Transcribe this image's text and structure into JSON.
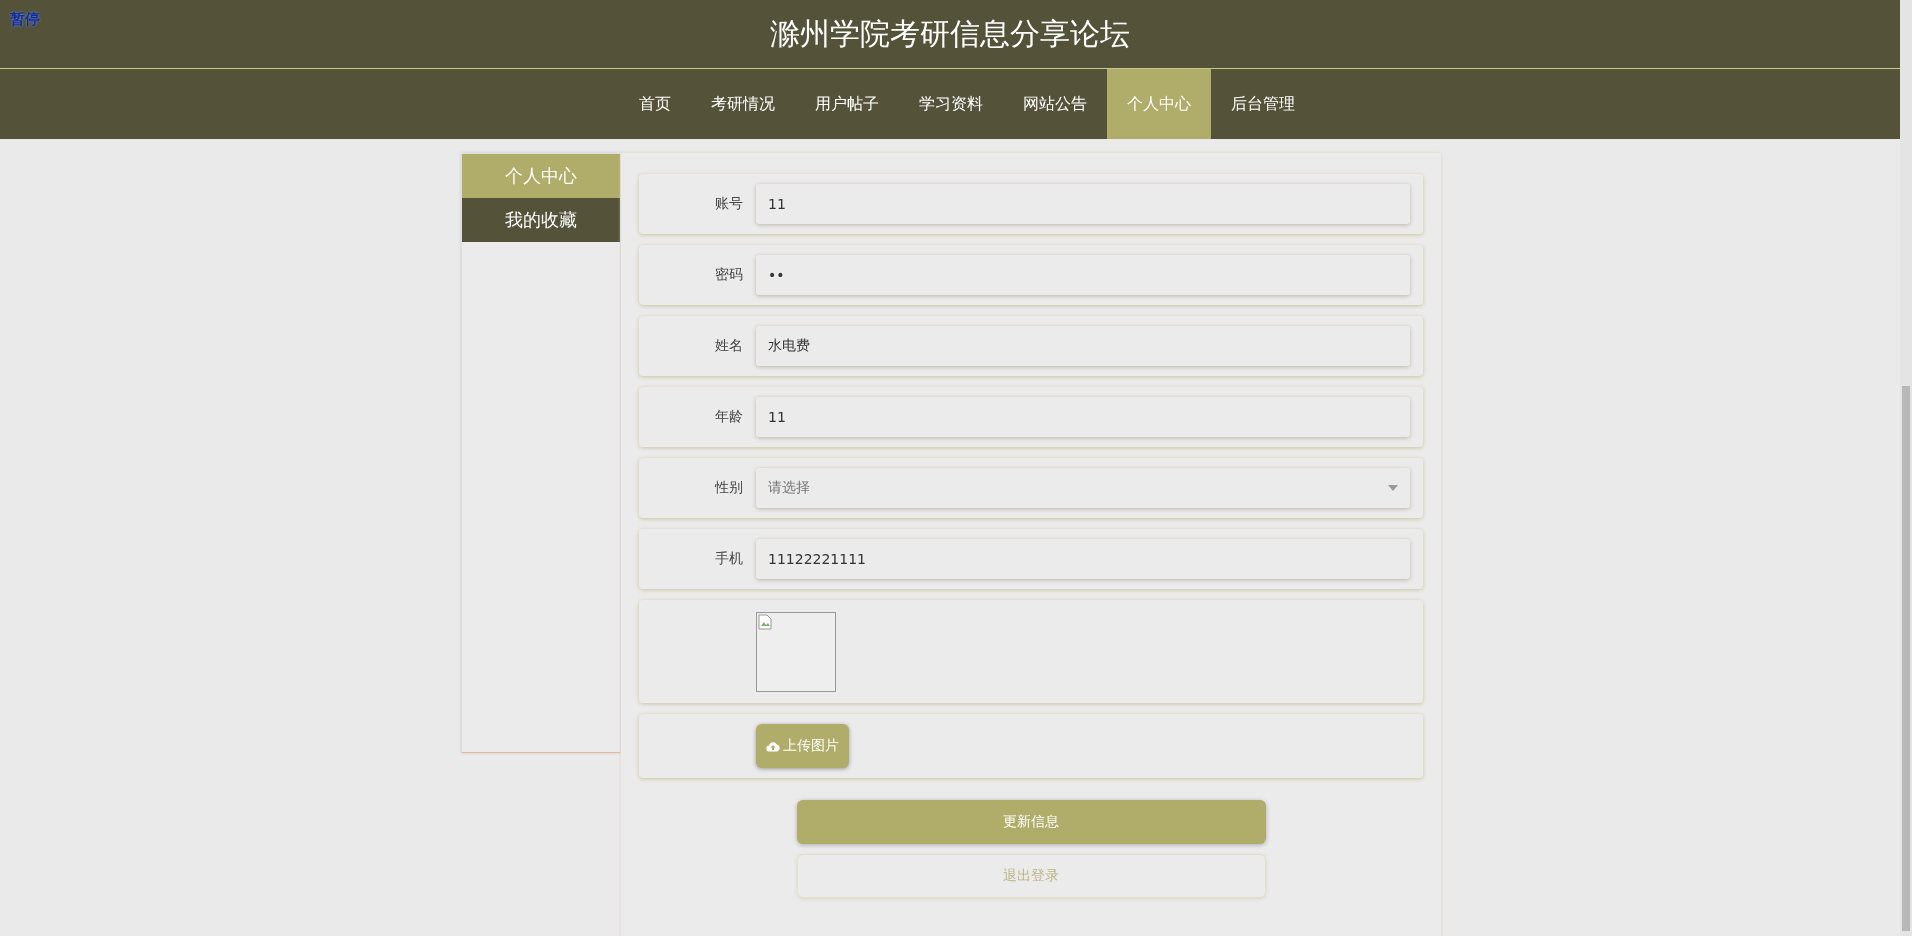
{
  "overlay_label": "暂停",
  "site_title": "滁州学院考研信息分享论坛",
  "nav": [
    {
      "label": "首页",
      "selected": false
    },
    {
      "label": "考研情况",
      "selected": false
    },
    {
      "label": "用户帖子",
      "selected": false
    },
    {
      "label": "学习资料",
      "selected": false
    },
    {
      "label": "网站公告",
      "selected": false
    },
    {
      "label": "个人中心",
      "selected": true
    },
    {
      "label": "后台管理",
      "selected": false
    }
  ],
  "sidebar": [
    {
      "label": "个人中心",
      "selected": true
    },
    {
      "label": "我的收藏",
      "selected": false
    }
  ],
  "form": {
    "fields": [
      {
        "kind": "text",
        "label": "账号",
        "value": "11"
      },
      {
        "kind": "text",
        "label": "密码",
        "value": "••"
      },
      {
        "kind": "text",
        "label": "姓名",
        "value": "水电费"
      },
      {
        "kind": "text",
        "label": "年龄",
        "value": "11"
      },
      {
        "kind": "select",
        "label": "性别",
        "placeholder": "请选择"
      },
      {
        "kind": "text",
        "label": "手机",
        "value": "11122221111"
      }
    ],
    "upload_button": "上传图片",
    "buttons": [
      {
        "kind": "primary",
        "label": "更新信息"
      },
      {
        "kind": "outline",
        "label": "退出登录"
      }
    ]
  }
}
